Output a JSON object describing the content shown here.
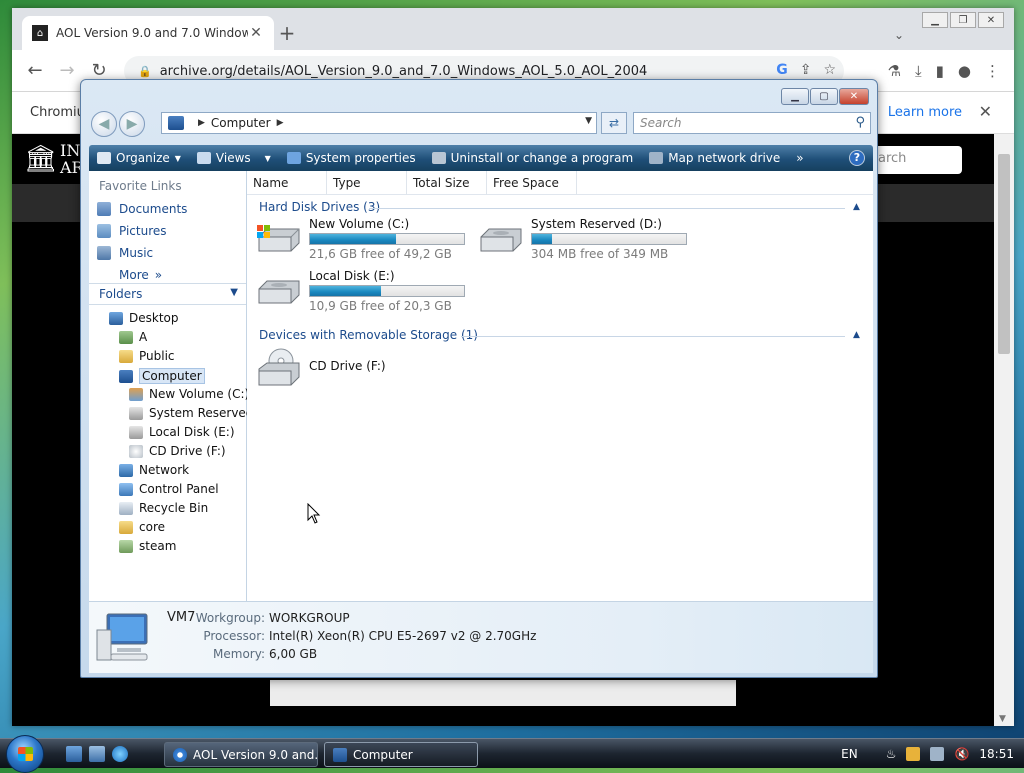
{
  "chrome": {
    "tab_title": "AOL Version 9.0 and 7.0 Window",
    "url": "archive.org/details/AOL_Version_9.0_and_7.0_Windows_AOL_5.0_AOL_2004",
    "infobar_label": "Chromiu",
    "learn_more": "Learn more",
    "archive_text": "IN\nAR",
    "search_placeholder": "earch"
  },
  "explorer": {
    "address": {
      "location": "Computer"
    },
    "search_placeholder": "Search",
    "commands": {
      "organize": "Organize",
      "views": "Views",
      "system_properties": "System properties",
      "uninstall": "Uninstall or change a program",
      "map_drive": "Map network drive",
      "more": "»"
    },
    "favorites": {
      "title": "Favorite Links",
      "items": [
        {
          "label": "Documents"
        },
        {
          "label": "Pictures"
        },
        {
          "label": "Music"
        },
        {
          "label": "More"
        }
      ]
    },
    "folders": {
      "title": "Folders",
      "items": [
        {
          "label": "Desktop"
        },
        {
          "label": "A"
        },
        {
          "label": "Public"
        },
        {
          "label": "Computer"
        },
        {
          "label": "New Volume (C:)"
        },
        {
          "label": "System Reserved ("
        },
        {
          "label": "Local Disk (E:)"
        },
        {
          "label": "CD Drive (F:)"
        },
        {
          "label": "Network"
        },
        {
          "label": "Control Panel"
        },
        {
          "label": "Recycle Bin"
        },
        {
          "label": "core"
        },
        {
          "label": "steam"
        }
      ]
    },
    "columns": [
      "Name",
      "Type",
      "Total Size",
      "Free Space"
    ],
    "groups": {
      "hdd": "Hard Disk Drives (3)",
      "removable": "Devices with Removable Storage (1)"
    },
    "drives": [
      {
        "name": "New Volume (C:)",
        "free": "21,6 GB free of 49,2 GB",
        "used_fraction": 0.56
      },
      {
        "name": "System Reserved (D:)",
        "free": "304 MB free of 349 MB",
        "used_fraction": 0.13
      },
      {
        "name": "Local Disk (E:)",
        "free": "10,9 GB free of 20,3 GB",
        "used_fraction": 0.46
      },
      {
        "name": "CD Drive (F:)"
      }
    ],
    "details": {
      "computer": "VM7",
      "workgroup_label": "Workgroup:",
      "workgroup": "WORKGROUP",
      "processor_label": "Processor:",
      "processor": "Intel(R) Xeon(R) CPU E5-2697 v2 @ 2.70GHz",
      "memory_label": "Memory:",
      "memory": "6,00 GB"
    }
  },
  "taskbar": {
    "buttons": [
      {
        "label": "AOL Version 9.0 and..."
      },
      {
        "label": "Computer"
      }
    ],
    "language": "EN",
    "clock": "18:51"
  },
  "colors": {
    "explorer_accent": "#1f4f78",
    "drive_bar": "#1a88c0",
    "link": "#1c4b8c"
  }
}
